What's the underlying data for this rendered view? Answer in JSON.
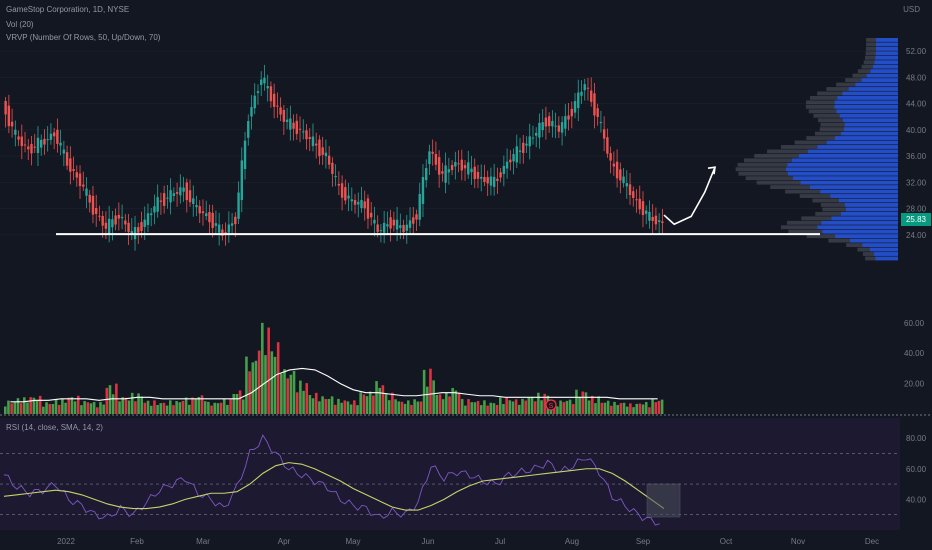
{
  "header": {
    "symbol_line": "GameStop Corporation, 1D, NYSE",
    "volume_line": "Vol (20)",
    "vrvp_line": "VRVP (Number Of Rows, 50, Up/Down, 70)",
    "rsi_line": "RSI (14, close, SMA, 14, 2)",
    "currency": "USD",
    "last_price": "25.83",
    "dividend_marker": "S"
  },
  "colors": {
    "background": "#131722",
    "up": "#26a69a",
    "down": "#ef5350",
    "volume_up": "#4caf50",
    "volume_down": "#f23645",
    "profile": "#2962ff",
    "rsi_line": "#7e57c2",
    "rsi_ma": "#c5d36b",
    "support_line": "#ffffff",
    "price_tag": "#089981"
  },
  "chart_data": [
    {
      "type": "candlestick",
      "ylim": [
        20,
        54
      ],
      "y_ticks": [
        "52.00",
        "48.00",
        "44.00",
        "40.00",
        "36.00",
        "32.00",
        "28.00",
        "24.00"
      ],
      "x_ticks": [
        "2022",
        "Feb",
        "Mar",
        "Apr",
        "May",
        "Jun",
        "Jul",
        "Aug",
        "Sep",
        "Oct",
        "Nov",
        "Dec"
      ],
      "support_level": 24.1,
      "projected_path": [
        [
          0,
          27.0
        ],
        [
          6,
          25.6
        ],
        [
          16,
          26.8
        ],
        [
          24,
          30.5
        ],
        [
          30,
          34.3
        ]
      ],
      "closes": [
        44,
        39,
        37,
        38,
        39.5,
        35,
        32,
        28,
        25,
        27,
        24,
        26,
        29,
        30,
        31,
        28,
        26.5,
        24,
        26.5,
        42,
        48,
        44,
        41,
        40,
        38,
        36,
        31,
        29,
        28.5,
        24.5,
        26,
        24.8,
        27,
        37,
        33,
        35,
        34,
        32.5,
        32,
        35,
        37,
        39,
        41.5,
        40,
        43,
        47,
        42,
        35,
        32,
        29,
        26.5,
        25.83
      ]
    },
    {
      "type": "bar",
      "name": "Vol (20)",
      "y_ticks": [
        "60.00",
        "40.00",
        "20.00"
      ],
      "ylim": [
        0,
        75
      ],
      "values": [
        9,
        11,
        12,
        8,
        10,
        12,
        9,
        8,
        20,
        12,
        14,
        9,
        8,
        9,
        11,
        13,
        8,
        10,
        16,
        38,
        60,
        48,
        30,
        22,
        14,
        12,
        10,
        9,
        15,
        22,
        14,
        9,
        10,
        30,
        14,
        18,
        10,
        9,
        8,
        11,
        10,
        12,
        14,
        9,
        10,
        16,
        12,
        9,
        8,
        7,
        8,
        10
      ],
      "ma": [
        8,
        8,
        9,
        9,
        10,
        10,
        10,
        9,
        10,
        10,
        11,
        11,
        10,
        10,
        10,
        10,
        10,
        10,
        10,
        14,
        20,
        26,
        29,
        30,
        29,
        25,
        20,
        16,
        14,
        14,
        13,
        12,
        12,
        13,
        14,
        14,
        13,
        12,
        12,
        11,
        11,
        11,
        11,
        11,
        11,
        11,
        11,
        11,
        10,
        10,
        10,
        10
      ]
    },
    {
      "type": "line",
      "name": "RSI (14, close, SMA, 14, 2)",
      "y_ticks": [
        "80.00",
        "60.00",
        "40.00"
      ],
      "ylim": [
        20,
        84
      ],
      "bands": [
        70,
        50,
        30
      ],
      "rsi": [
        56,
        48,
        44,
        46,
        50,
        40,
        36,
        30,
        28,
        34,
        30,
        38,
        46,
        50,
        54,
        44,
        40,
        34,
        48,
        70,
        80,
        70,
        60,
        56,
        52,
        48,
        40,
        36,
        34,
        28,
        32,
        30,
        38,
        62,
        54,
        58,
        56,
        52,
        50,
        56,
        58,
        60,
        64,
        58,
        62,
        68,
        58,
        42,
        36,
        30,
        26,
        24
      ],
      "rsi_ma": [
        42,
        43,
        44,
        45,
        46,
        45,
        43,
        40,
        37,
        35,
        34,
        34,
        35,
        37,
        40,
        42,
        44,
        44,
        45,
        50,
        57,
        62,
        64,
        63,
        60,
        56,
        52,
        47,
        43,
        39,
        35,
        33,
        33,
        36,
        40,
        45,
        49,
        52,
        53,
        54,
        55,
        56,
        57,
        58,
        59,
        60,
        60,
        57,
        52,
        46,
        40,
        34
      ]
    }
  ]
}
